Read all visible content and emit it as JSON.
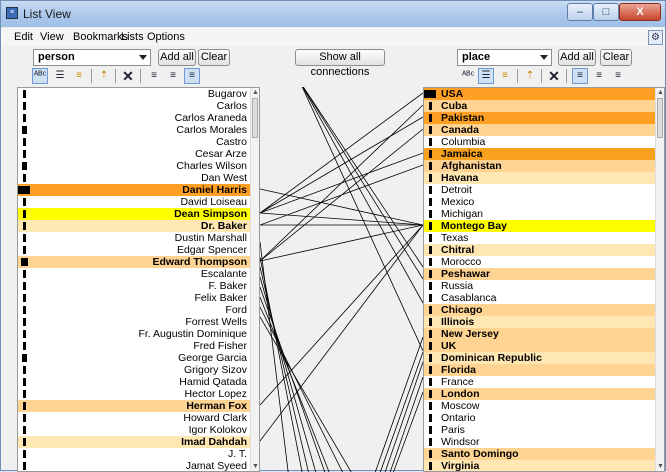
{
  "window": {
    "title": "List View",
    "title_icon": "list-app-icon",
    "controls": {
      "minimize": "–",
      "maximize": "□",
      "close": "X"
    }
  },
  "menu": [
    "Edit",
    "View",
    "Bookmarks",
    "Lists",
    "Options"
  ],
  "left_panel": {
    "selector": "person",
    "add_all": "Add all",
    "clear": "Clear"
  },
  "center": {
    "show_all": "Show all connections"
  },
  "right_panel": {
    "selector": "place",
    "add_all": "Add all",
    "clear": "Clear"
  },
  "toolbar_icons": [
    "abc-sort-icon",
    "list-lines-icon",
    "list-bars-icon",
    "sort-up-icon",
    "clear-x-icon",
    "align-left-icon",
    "align-center-icon",
    "align-right-icon"
  ],
  "colors": {
    "highlight_strong": "#ffa024",
    "highlight_medium": "#ffd391",
    "highlight_light": "#ffe7b3",
    "selected_yellow": "#ffff00",
    "connection_line": "#000000"
  },
  "persons": [
    {
      "name": "Bugarov",
      "w": 3,
      "hl": "",
      "b": false
    },
    {
      "name": "Carlos",
      "w": 3,
      "hl": "",
      "b": false
    },
    {
      "name": "Carlos Araneda",
      "w": 3,
      "hl": "",
      "b": false
    },
    {
      "name": "Carlos Morales",
      "w": 5,
      "hl": "",
      "b": false
    },
    {
      "name": "Castro",
      "w": 3,
      "hl": "",
      "b": false
    },
    {
      "name": "Cesar Arze",
      "w": 3,
      "hl": "",
      "b": false
    },
    {
      "name": "Charles Wilson",
      "w": 5,
      "hl": "",
      "b": false
    },
    {
      "name": "Dan West",
      "w": 3,
      "hl": "",
      "b": false
    },
    {
      "name": "Daniel Harris",
      "w": 12,
      "hl": "h1",
      "b": true
    },
    {
      "name": "David Loiseau",
      "w": 3,
      "hl": "",
      "b": false
    },
    {
      "name": "Dean Simpson",
      "w": 3,
      "hl": "hy",
      "b": true
    },
    {
      "name": "Dr. Baker",
      "w": 3,
      "hl": "h3",
      "b": true
    },
    {
      "name": "Dustin Marshall",
      "w": 3,
      "hl": "",
      "b": false
    },
    {
      "name": "Edgar Spencer",
      "w": 3,
      "hl": "",
      "b": false
    },
    {
      "name": "Edward Thompson",
      "w": 7,
      "hl": "h2",
      "b": true
    },
    {
      "name": "Escalante",
      "w": 3,
      "hl": "",
      "b": false
    },
    {
      "name": "F. Baker",
      "w": 3,
      "hl": "",
      "b": false
    },
    {
      "name": "Felix Baker",
      "w": 3,
      "hl": "",
      "b": false
    },
    {
      "name": "Ford",
      "w": 3,
      "hl": "",
      "b": false
    },
    {
      "name": "Forrest Wells",
      "w": 3,
      "hl": "",
      "b": false
    },
    {
      "name": "Fr. Augustin Dominique",
      "w": 3,
      "hl": "",
      "b": false
    },
    {
      "name": "Fred Fisher",
      "w": 3,
      "hl": "",
      "b": false
    },
    {
      "name": "George Garcia",
      "w": 5,
      "hl": "",
      "b": false
    },
    {
      "name": "Grigory Sizov",
      "w": 3,
      "hl": "",
      "b": false
    },
    {
      "name": "Hamid Qatada",
      "w": 3,
      "hl": "",
      "b": false
    },
    {
      "name": "Hector Lopez",
      "w": 3,
      "hl": "",
      "b": false
    },
    {
      "name": "Herman Fox",
      "w": 3,
      "hl": "h2",
      "b": true
    },
    {
      "name": "Howard Clark",
      "w": 3,
      "hl": "",
      "b": false
    },
    {
      "name": "Igor Kolokov",
      "w": 3,
      "hl": "",
      "b": false
    },
    {
      "name": "Imad Dahdah",
      "w": 3,
      "hl": "h3",
      "b": true
    },
    {
      "name": "J. T.",
      "w": 3,
      "hl": "",
      "b": false
    },
    {
      "name": "Jamat Syeed",
      "w": 3,
      "hl": "",
      "b": false
    }
  ],
  "places": [
    {
      "name": "USA",
      "w": 12,
      "hl": "h1",
      "b": true
    },
    {
      "name": "Cuba",
      "w": 3,
      "hl": "h2",
      "b": true
    },
    {
      "name": "Pakistan",
      "w": 3,
      "hl": "h1",
      "b": true
    },
    {
      "name": "Canada",
      "w": 3,
      "hl": "h2",
      "b": true
    },
    {
      "name": "Columbia",
      "w": 3,
      "hl": "",
      "b": false
    },
    {
      "name": "Jamaica",
      "w": 3,
      "hl": "h4",
      "b": true
    },
    {
      "name": "Afghanistan",
      "w": 3,
      "hl": "h2",
      "b": true
    },
    {
      "name": "Havana",
      "w": 3,
      "hl": "h3",
      "b": true
    },
    {
      "name": "Detroit",
      "w": 3,
      "hl": "",
      "b": false
    },
    {
      "name": "Mexico",
      "w": 3,
      "hl": "",
      "b": false
    },
    {
      "name": "Michigan",
      "w": 3,
      "hl": "",
      "b": false
    },
    {
      "name": "Montego Bay",
      "w": 3,
      "hl": "hy",
      "b": true
    },
    {
      "name": "Texas",
      "w": 3,
      "hl": "",
      "b": false
    },
    {
      "name": "Chitral",
      "w": 3,
      "hl": "h3",
      "b": true
    },
    {
      "name": "Morocco",
      "w": 3,
      "hl": "",
      "b": false
    },
    {
      "name": "Peshawar",
      "w": 3,
      "hl": "h2",
      "b": true
    },
    {
      "name": "Russia",
      "w": 3,
      "hl": "",
      "b": false
    },
    {
      "name": "Casablanca",
      "w": 3,
      "hl": "",
      "b": false
    },
    {
      "name": "Chicago",
      "w": 3,
      "hl": "h2",
      "b": true
    },
    {
      "name": "Illinois",
      "w": 3,
      "hl": "h3",
      "b": true
    },
    {
      "name": "New Jersey",
      "w": 3,
      "hl": "h2",
      "b": true
    },
    {
      "name": "UK",
      "w": 3,
      "hl": "h2",
      "b": true
    },
    {
      "name": "Dominican Republic",
      "w": 3,
      "hl": "h3",
      "b": true
    },
    {
      "name": "Florida",
      "w": 3,
      "hl": "h2",
      "b": true
    },
    {
      "name": "France",
      "w": 3,
      "hl": "",
      "b": false
    },
    {
      "name": "London",
      "w": 3,
      "hl": "h2",
      "b": true
    },
    {
      "name": "Moscow",
      "w": 3,
      "hl": "",
      "b": false
    },
    {
      "name": "Ontario",
      "w": 3,
      "hl": "",
      "b": false
    },
    {
      "name": "Paris",
      "w": 3,
      "hl": "",
      "b": false
    },
    {
      "name": "Windsor",
      "w": 3,
      "hl": "",
      "b": false
    },
    {
      "name": "Santo Domingo",
      "w": 3,
      "hl": "h2",
      "b": true
    },
    {
      "name": "Virginia",
      "w": 3,
      "hl": "h3",
      "b": true
    }
  ],
  "connections": [
    [
      10,
      11
    ],
    [
      10,
      0
    ],
    [
      10,
      2
    ],
    [
      10,
      5
    ],
    [
      14,
      11
    ],
    [
      14,
      1
    ],
    [
      14,
      3
    ],
    [
      8,
      11
    ],
    [
      11,
      11
    ],
    [
      11,
      6
    ],
    [
      26,
      11
    ],
    [
      29,
      11
    ]
  ]
}
